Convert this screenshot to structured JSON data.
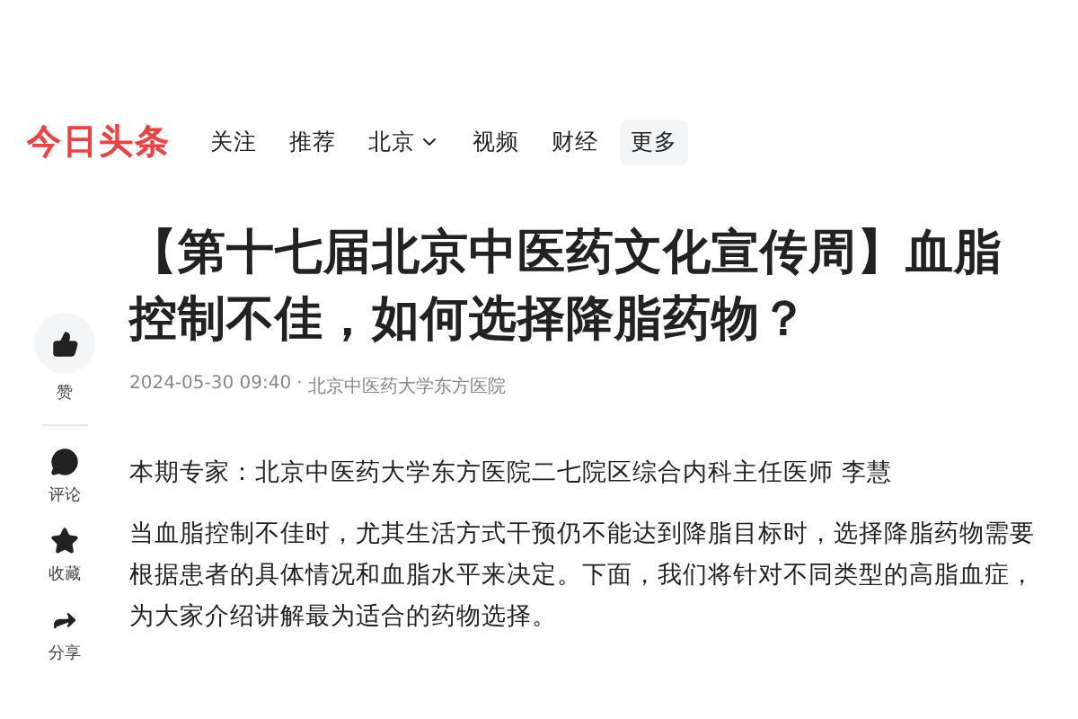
{
  "header": {
    "logo": "今日头条",
    "nav": [
      {
        "label": "关注",
        "kind": "link"
      },
      {
        "label": "推荐",
        "kind": "link"
      },
      {
        "label": "北京",
        "kind": "dropdown"
      },
      {
        "label": "视频",
        "kind": "link"
      },
      {
        "label": "财经",
        "kind": "link"
      },
      {
        "label": "更多",
        "kind": "more"
      }
    ]
  },
  "actions": [
    {
      "label": "赞",
      "kind": "like"
    },
    {
      "label": "评论",
      "kind": "comment"
    },
    {
      "label": "收藏",
      "kind": "star"
    },
    {
      "label": "分享",
      "kind": "share"
    }
  ],
  "article": {
    "title": "【第十七届北京中医药文化宣传周】血脂控制不佳，如何选择降脂药物？",
    "date": "2024-05-30 09:40",
    "separator": "·",
    "source": "北京中医药大学东方医院",
    "paragraphs": [
      "本期专家：北京中医药大学东方医院二七院区综合内科主任医师 李慧",
      "当血脂控制不佳时，尤其生活方式干预仍不能达到降脂目标时，选择降脂药物需要根据患者的具体情况和血脂水平来决定。下面，我们将针对不同类型的高脂血症，为大家介绍讲解最为适合的药物选择。"
    ]
  }
}
